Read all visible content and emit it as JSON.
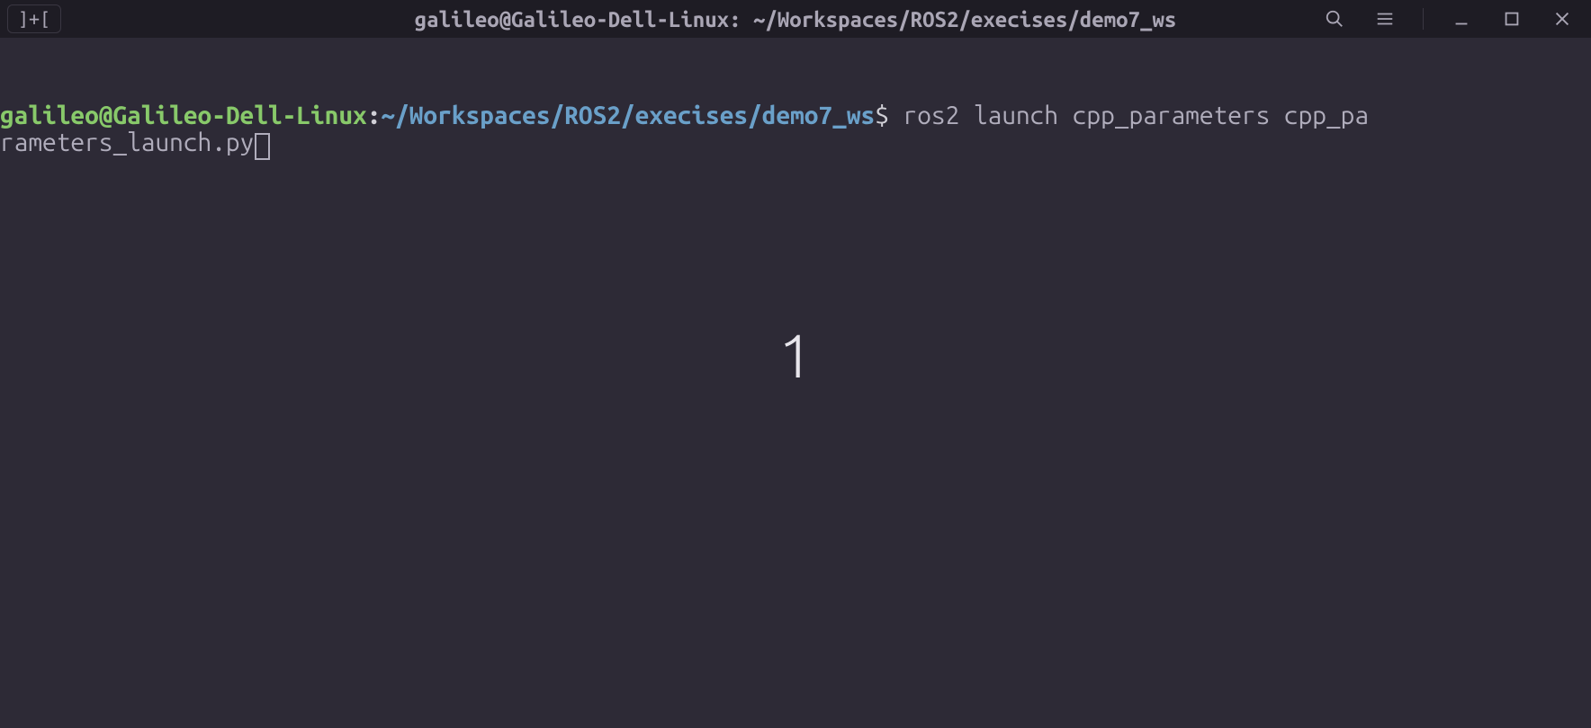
{
  "titlebar": {
    "new_tab_label": "]+[",
    "title": "galileo@Galileo-Dell-Linux: ~/Workspaces/ROS2/execises/demo7_ws"
  },
  "prompt": {
    "user_host": "galileo@Galileo-Dell-Linux",
    "colon": ":",
    "cwd": "~/Workspaces/ROS2/execises/demo7_ws",
    "dollar": "$ ",
    "command_row1": "ros2 launch cpp_parameters cpp_pa",
    "command_row2": "rameters_launch.py"
  },
  "overlay": {
    "workspace_number": "1"
  },
  "icons": {
    "search": "search-icon",
    "menu": "hamburger-menu-icon",
    "minimize": "minimize-icon",
    "maximize": "maximize-icon",
    "close": "close-icon"
  }
}
